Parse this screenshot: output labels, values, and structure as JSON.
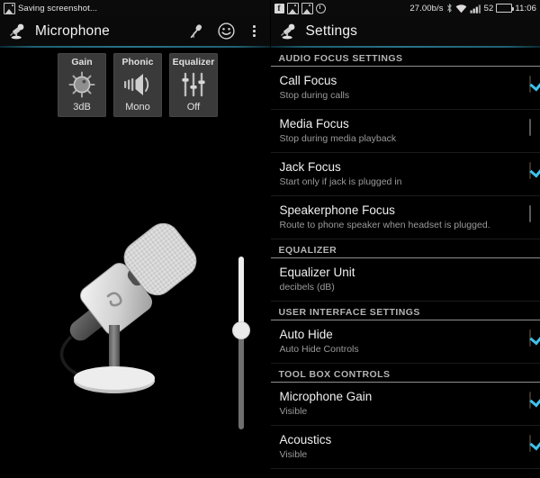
{
  "left": {
    "statusbar": {
      "notification_icon": "image-icon",
      "notification_text": "Saving screenshot..."
    },
    "actionbar": {
      "app_icon": "desk-microphone-icon",
      "title": "Microphone",
      "actions": [
        {
          "icon": "handheld-microphone-icon",
          "name": "record-source-button"
        },
        {
          "icon": "smiley-face-icon",
          "name": "smiley-button"
        },
        {
          "icon": "overflow-menu-icon",
          "name": "overflow-menu-button"
        }
      ]
    },
    "toolbox": [
      {
        "label": "Gain",
        "icon": "knob-icon",
        "value": "3dB"
      },
      {
        "label": "Phonic",
        "icon": "speaker-icon",
        "value": "Mono"
      },
      {
        "label": "Equalizer",
        "icon": "equalizer-sliders-icon",
        "value": "Off"
      }
    ],
    "artwork": {
      "name": "desk-microphone-illustration"
    },
    "gain_slider": {
      "name": "gain-slider",
      "orientation": "vertical",
      "thumb_position_pct": 42
    }
  },
  "right": {
    "statusbar": {
      "icons": [
        "facebook-icon",
        "gallery-icon",
        "screenshot-icon",
        "circle-icon"
      ],
      "network_speed": "27.00b/s",
      "bluetooth": "bluetooth-icon",
      "wifi": "wifi-icon",
      "signal": "signal-bars-icon",
      "battery_level": "52",
      "battery_icon": "battery-icon",
      "clock": "11:06"
    },
    "actionbar": {
      "app_icon": "desk-microphone-icon",
      "title": "Settings"
    },
    "sections": [
      {
        "header": "AUDIO FOCUS SETTINGS",
        "items": [
          {
            "title": "Call Focus",
            "subtitle": "Stop during calls",
            "checked": true
          },
          {
            "title": "Media Focus",
            "subtitle": "Stop during media playback",
            "checked": false
          },
          {
            "title": "Jack Focus",
            "subtitle": "Start only if jack is plugged in",
            "checked": true
          },
          {
            "title": "Speakerphone Focus",
            "subtitle": "Route to phone speaker when headset is plugged.",
            "checked": false
          }
        ]
      },
      {
        "header": "EQUALIZER",
        "items": [
          {
            "title": "Equalizer Unit",
            "subtitle": "decibels (dB)",
            "checked": null
          }
        ]
      },
      {
        "header": "USER INTERFACE SETTINGS",
        "items": [
          {
            "title": "Auto Hide",
            "subtitle": "Auto Hide Controls",
            "checked": true
          }
        ]
      },
      {
        "header": "TOOL BOX CONTROLS",
        "items": [
          {
            "title": "Microphone Gain",
            "subtitle": "Visible",
            "checked": true
          },
          {
            "title": "Acoustics",
            "subtitle": "Visible",
            "checked": true
          }
        ]
      }
    ]
  },
  "colors": {
    "accent_divider": "#2a7389",
    "checkbox_check": "#3fc1ea",
    "battery_green": "#4fd22c",
    "card_bg": "#3a3a3a"
  }
}
